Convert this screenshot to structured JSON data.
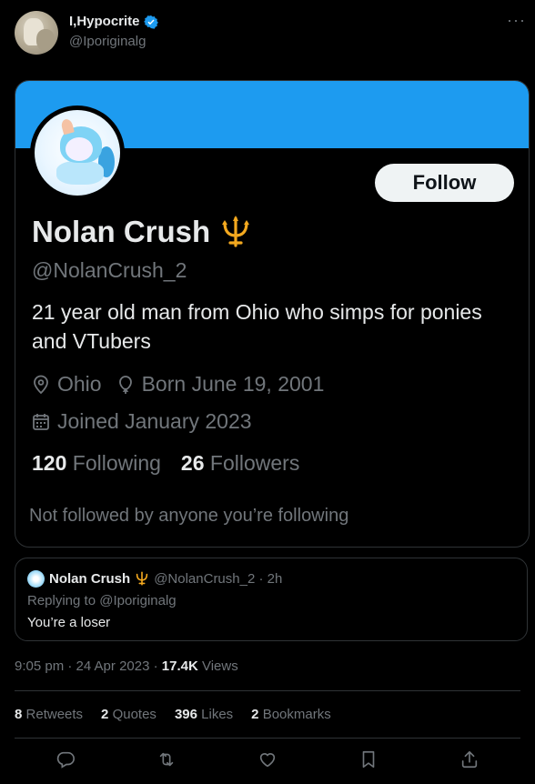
{
  "author": {
    "name": "I,Hypocrite",
    "handle": "@Iporiginalg",
    "more_label": "···"
  },
  "profile_card": {
    "banner_color": "#1d9bf0",
    "follow_label": "Follow",
    "name": "Nolan Crush",
    "name_emoji": "trident-icon",
    "handle": "@NolanCrush_2",
    "bio": "21 year old man from Ohio who simps for ponies and VTubers",
    "location": "Ohio",
    "birthday": "Born June 19, 2001",
    "joined": "Joined January 2023",
    "following_count": "120",
    "following_label": "Following",
    "followers_count": "26",
    "followers_label": "Followers",
    "not_followed": "Not followed by anyone you’re following"
  },
  "reply": {
    "name": "Nolan Crush",
    "handle_time": "@NolanCrush_2 · 2h",
    "replying_to": "Replying to @Iporiginalg",
    "text": "You’re a loser"
  },
  "timestamp": {
    "time_date": "9:05 pm · 24 Apr 2023 · ",
    "views_count": "17.4K",
    "views_label": " Views"
  },
  "stats": {
    "retweets_count": "8",
    "retweets_label": "Retweets",
    "quotes_count": "2",
    "quotes_label": "Quotes",
    "likes_count": "396",
    "likes_label": "Likes",
    "bookmarks_count": "2",
    "bookmarks_label": "Bookmarks"
  },
  "actions": [
    "reply-icon",
    "retweet-icon",
    "like-icon",
    "bookmark-icon",
    "share-icon"
  ],
  "colors": {
    "accent": "#1d9bf0",
    "text": "#e7e9ea",
    "muted": "#71767b",
    "border": "#2f3336",
    "emoji": "#f4a91f"
  }
}
